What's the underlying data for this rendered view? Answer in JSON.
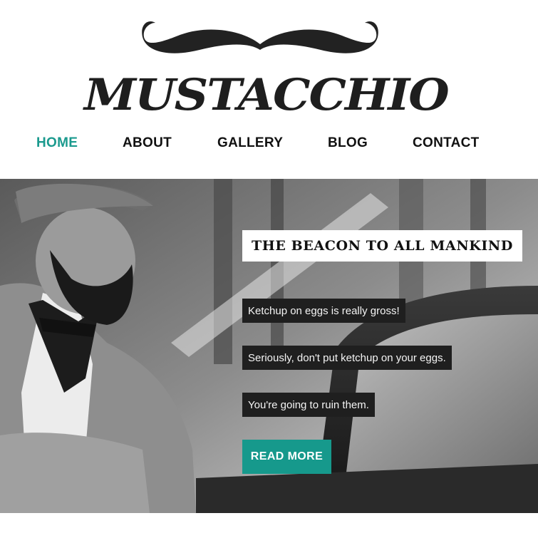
{
  "brand": {
    "name": "MUSTACCHIO",
    "logo_icon": "mustache-icon"
  },
  "nav": {
    "items": [
      {
        "label": "HOME",
        "active": true
      },
      {
        "label": "ABOUT",
        "active": false
      },
      {
        "label": "GALLERY",
        "active": false
      },
      {
        "label": "BLOG",
        "active": false
      },
      {
        "label": "CONTACT",
        "active": false
      }
    ],
    "active_color": "#1b9a8e"
  },
  "hero": {
    "title": "THE BEACON TO ALL MANKIND",
    "captions": [
      "Ketchup on eggs is really gross!",
      "Seriously, don't put ketchup on your eggs.",
      "You're going to ruin them."
    ],
    "button_label": "READ MORE",
    "button_color": "#16998c",
    "image": "bearded-man-with-vintage-car-photo"
  }
}
